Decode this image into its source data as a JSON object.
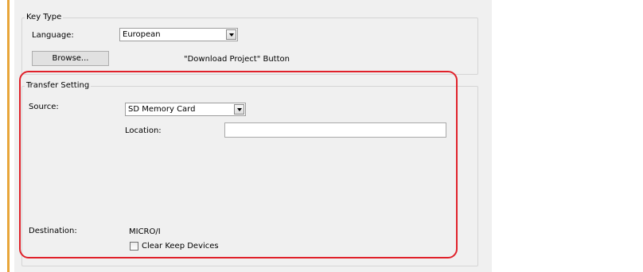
{
  "key_type": {
    "title": "Key Type",
    "language_label": "Language:",
    "language_value": "European",
    "browse_label": "Browse...",
    "download_note": "\"Download Project\" Button"
  },
  "transfer": {
    "title": "Transfer Setting",
    "source_label": "Source:",
    "source_value": "SD Memory Card",
    "location_label": "Location:",
    "location_value": "",
    "destination_label": "Destination:",
    "destination_value": "MICRO/I",
    "clear_keep_label": "Clear Keep Devices",
    "clear_keep_checked": false
  },
  "colors": {
    "accent_bar": "#e8a63a",
    "highlight": "#e0212a"
  }
}
